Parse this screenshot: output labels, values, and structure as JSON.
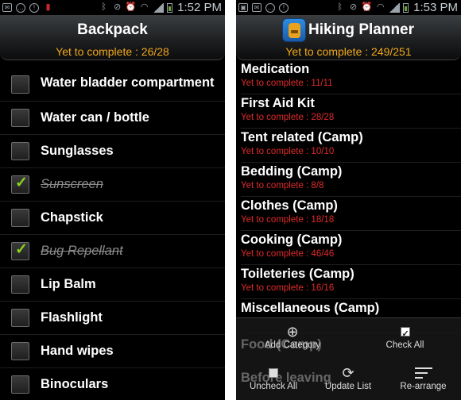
{
  "left_screen": {
    "status_time": "1:52 PM",
    "title": "Backpack",
    "subtitle": "Yet to complete : 26/28",
    "items": [
      {
        "label": "Water bladder compartment",
        "checked": false
      },
      {
        "label": "Water can / bottle",
        "checked": false
      },
      {
        "label": "Sunglasses",
        "checked": false
      },
      {
        "label": "Sunscreen",
        "checked": true
      },
      {
        "label": "Chapstick",
        "checked": false
      },
      {
        "label": "Bug Repellant",
        "checked": true
      },
      {
        "label": "Lip Balm",
        "checked": false
      },
      {
        "label": "Flashlight",
        "checked": false
      },
      {
        "label": "Hand wipes",
        "checked": false
      },
      {
        "label": "Binoculars",
        "checked": false
      }
    ]
  },
  "right_screen": {
    "status_time": "1:53 PM",
    "title": "Hiking Planner",
    "subtitle": "Yet to complete : 249/251",
    "categories": [
      {
        "name": "Medication",
        "remaining": "Yet to complete : 11/11"
      },
      {
        "name": "First Aid Kit",
        "remaining": "Yet to complete : 28/28"
      },
      {
        "name": "Tent related (Camp)",
        "remaining": "Yet to complete : 10/10"
      },
      {
        "name": "Bedding (Camp)",
        "remaining": "Yet to complete : 8/8"
      },
      {
        "name": "Clothes (Camp)",
        "remaining": "Yet to complete : 18/18"
      },
      {
        "name": "Cooking (Camp)",
        "remaining": "Yet to complete : 46/46"
      },
      {
        "name": "Toileteries (Camp)",
        "remaining": "Yet to complete : 16/16"
      },
      {
        "name": "Miscellaneous (Camp)",
        "remaining": ""
      }
    ],
    "hidden_categories": {
      "food": "Food (Camp)",
      "before_leaving": "Before leaving"
    },
    "actions": {
      "add_category": "Add Category",
      "check_all": "Check All",
      "uncheck_all": "Uncheck All",
      "update_list": "Update List",
      "rearrange": "Re-arrange"
    }
  },
  "colors": {
    "accent_orange": "#f0a81a",
    "remaining_red": "#e02a2a",
    "check_green": "#8bd41c"
  },
  "icons": {
    "status_left": [
      "mail-icon",
      "chat-icon",
      "alert-icon",
      "battery-alert-icon"
    ],
    "status_right": [
      "bluetooth-icon",
      "mute-icon",
      "alarm-icon",
      "wifi-icon",
      "signal-icon",
      "battery-icon"
    ]
  }
}
